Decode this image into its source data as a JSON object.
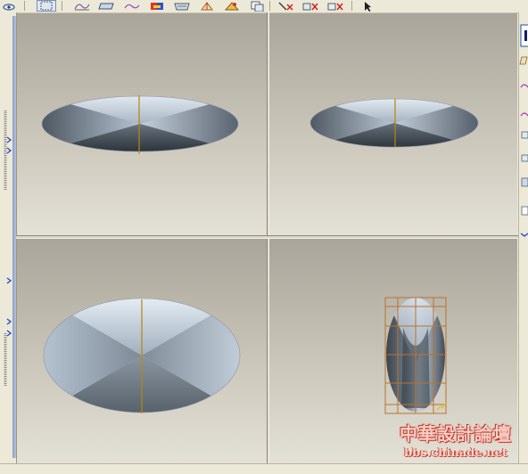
{
  "toolbar": {
    "buttons": [
      {
        "name": "view-orient-icon"
      },
      {
        "name": "select-mode-icon"
      },
      {
        "name": "sketch-curve-icon"
      },
      {
        "name": "datum-plane-icon"
      },
      {
        "name": "spline-icon"
      },
      {
        "name": "surface-color-icon"
      },
      {
        "name": "surface-analysis-icon"
      },
      {
        "name": "draft-check-icon"
      },
      {
        "name": "surface-shade-icon"
      },
      {
        "name": "copy-surface-icon"
      },
      {
        "name": "pick-delete-icon"
      },
      {
        "name": "cancel-delete-icon"
      },
      {
        "name": "remove-delete-icon"
      },
      {
        "name": "cursor-select-icon"
      }
    ]
  },
  "viewports": [
    {
      "name": "viewport-top-left",
      "view": "front"
    },
    {
      "name": "viewport-top-right",
      "view": "right"
    },
    {
      "name": "viewport-bottom-left",
      "view": "top"
    },
    {
      "name": "viewport-bottom-right",
      "view": "perspective"
    }
  ],
  "colors": {
    "background_top": "#aaa59a",
    "background_bottom": "#e4e1d7",
    "surface_light": "#d8e2ec",
    "surface_dark": "#3c444c",
    "axis_line": "#b8860b",
    "control_cage": "#b87333",
    "ui_chrome": "#ece9d8"
  },
  "watermark": {
    "title": "中華設計論壇",
    "url": "bbs.chinade.net"
  }
}
